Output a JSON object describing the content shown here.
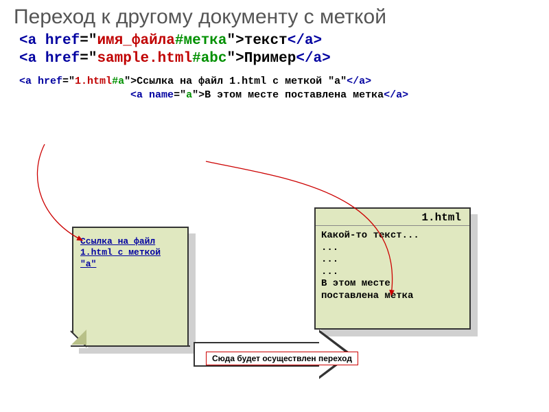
{
  "title": "Переход к другому документу с меткой",
  "code_lines": {
    "l1": {
      "open_a": "<a ",
      "attr": "href",
      "eq": "=\"",
      "v1": "имя_файла",
      "hash": "#",
      "v2": "метка",
      "close_q": "\">",
      "text": "текст",
      "close_a": "</a>"
    },
    "l2": {
      "open_a": "<a ",
      "attr": "href",
      "eq": "=\"",
      "v1": "sample.html",
      "hash": "#",
      "v2": "abc",
      "close_q": "\">",
      "text": "Пример",
      "close_a": "</a>"
    },
    "l3": {
      "open_a": "<a ",
      "attr": "href",
      "eq": "=\"",
      "v1": "1.html",
      "hash": "#",
      "v2": "a",
      "close_q": "\">",
      "text": "Ссылка на файл 1.html с меткой \"a\"",
      "close_a": "</a>"
    },
    "l4": {
      "indent": "                  ",
      "open_a": "<a ",
      "attr": "name",
      "eq": "=\"",
      "v2": "a",
      "close_q": "\">",
      "text": "В этом месте поставлена метка",
      "close_a": "</a>"
    }
  },
  "doc_left_link": "Ссылка на файл 1.html с меткой \"a\"",
  "doc_right": {
    "title": "1.html",
    "body": "Какой-то текст...\n...\n...\n...\nВ этом месте\nпоставлена метка"
  },
  "arrow_caption": "Сюда будет осуществлен переход"
}
